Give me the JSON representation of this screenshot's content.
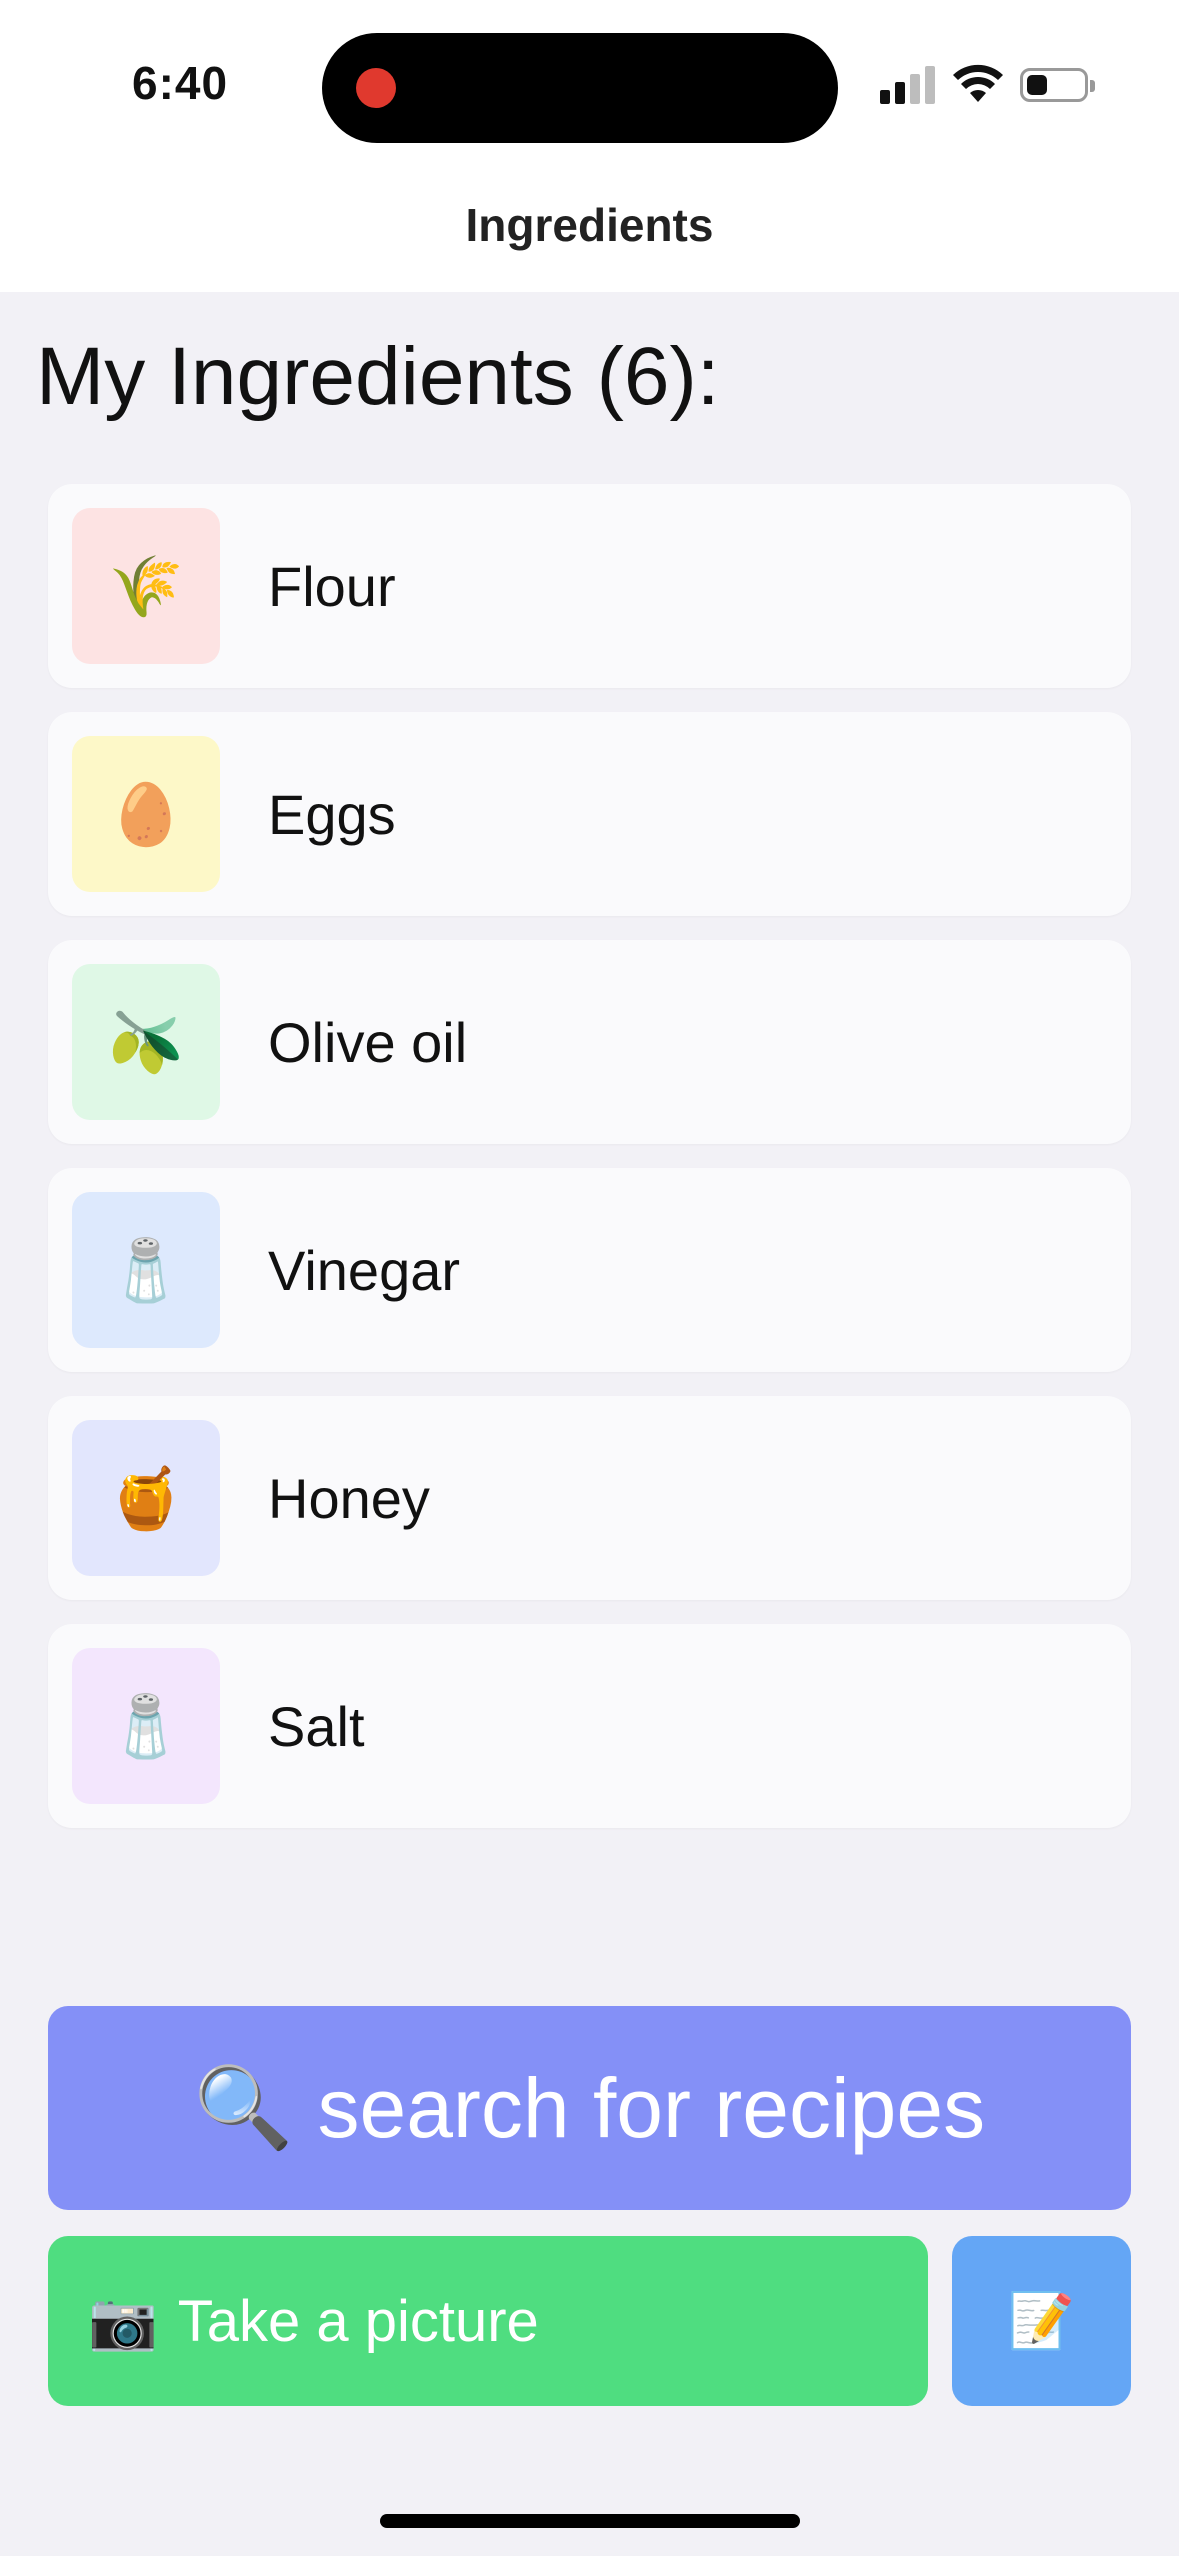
{
  "status_bar": {
    "time": "6:40",
    "icons": [
      "recording-indicator",
      "cellular-signal-icon",
      "wifi-icon",
      "battery-icon"
    ]
  },
  "nav": {
    "title": "Ingredients"
  },
  "section_title": "My Ingredients (6):",
  "ingredients": [
    {
      "label": "Flour",
      "icon": "🌾",
      "icon_name": "rice-sheaf-icon",
      "bg": "#fde3e3"
    },
    {
      "label": "Eggs",
      "icon": "🥚",
      "icon_name": "egg-icon",
      "bg": "#fdf8c8"
    },
    {
      "label": "Olive oil",
      "icon": "🫒",
      "icon_name": "olive-icon",
      "bg": "#dff8e6"
    },
    {
      "label": "Vinegar",
      "icon": "🧂",
      "icon_name": "salt-shaker-icon",
      "bg": "#dde9fd"
    },
    {
      "label": "Honey",
      "icon": "🍯",
      "icon_name": "honey-pot-icon",
      "bg": "#e2e6fd"
    },
    {
      "label": "Salt",
      "icon": "🧂",
      "icon_name": "salt-shaker-icon",
      "bg": "#f3e6fd"
    }
  ],
  "actions": {
    "search": {
      "icon": "🔍",
      "label": "search for recipes",
      "color": "#8490f7"
    },
    "photo": {
      "icon": "📷",
      "label": "Take a picture",
      "color": "#4fdd80"
    },
    "note": {
      "icon": "📝",
      "color": "#64a6f5"
    }
  }
}
